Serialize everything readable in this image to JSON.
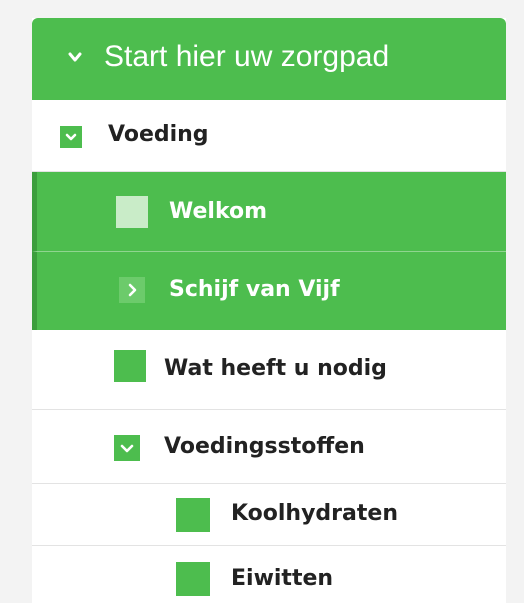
{
  "header": {
    "title": "Start hier uw zorgpad",
    "icon": "chevron-down-icon"
  },
  "colors": {
    "accent": "#4dbd4e",
    "accent_dark": "#3c9e3d",
    "pale_box": "#c9ecc8",
    "text_dark": "#222222"
  },
  "menu": {
    "items": [
      {
        "label": "Voeding",
        "icon": "chevron-down-icon",
        "state": "expanded",
        "level": 1
      },
      {
        "label": "Welkom",
        "icon": "pale-square-icon",
        "state": "active",
        "level": 2
      },
      {
        "label": "Schijf van Vijf",
        "icon": "chevron-right-icon",
        "state": "active",
        "level": 2
      },
      {
        "label": "Wat heeft u nodig",
        "icon": "square-icon",
        "state": "default",
        "level": 2
      },
      {
        "label": "Voedingsstoffen",
        "icon": "chevron-down-icon",
        "state": "expanded",
        "level": 2
      },
      {
        "label": "Koolhydraten",
        "icon": "square-icon",
        "state": "default",
        "level": 3
      },
      {
        "label": "Eiwitten",
        "icon": "square-icon",
        "state": "default",
        "level": 3
      }
    ]
  }
}
